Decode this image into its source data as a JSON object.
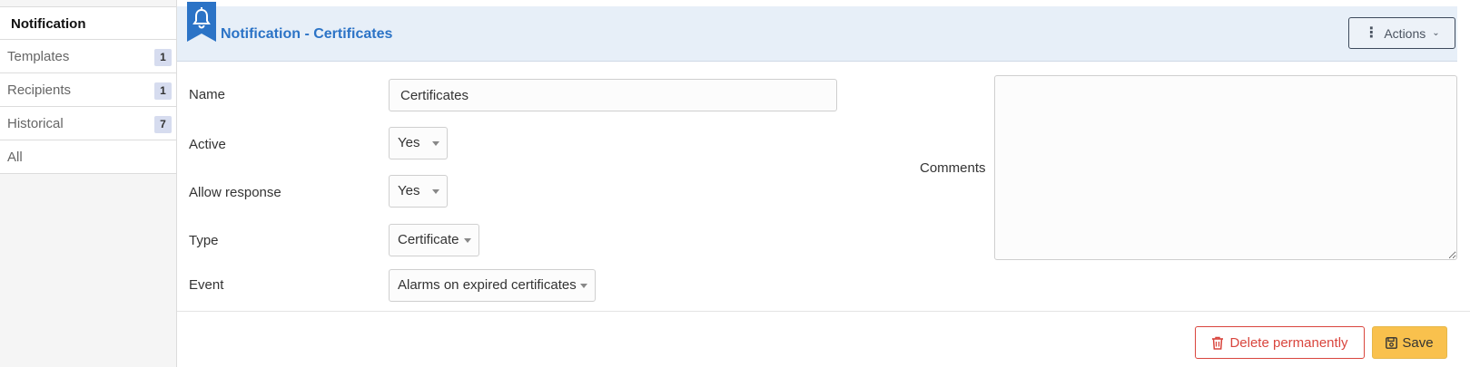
{
  "sidebar": {
    "heading": "Notification",
    "items": [
      {
        "label": "Templates",
        "badge": "1"
      },
      {
        "label": "Recipients",
        "badge": "1"
      },
      {
        "label": "Historical",
        "badge": "7"
      },
      {
        "label": "All",
        "badge": ""
      }
    ]
  },
  "header": {
    "title": "Notification - Certificates",
    "actions_label": "Actions",
    "icon": "bell-icon",
    "accent": "#2b73c6"
  },
  "form": {
    "name_label": "Name",
    "name_value": "Certificates",
    "active_label": "Active",
    "active_value": "Yes",
    "allow_response_label": "Allow response",
    "allow_response_value": "Yes",
    "type_label": "Type",
    "type_value": "Certificate",
    "event_label": "Event",
    "event_value": "Alarms on expired certificates",
    "comments_label": "Comments",
    "comments_value": ""
  },
  "footer": {
    "delete_label": "Delete permanently",
    "save_label": "Save",
    "delete_color": "#d9453d",
    "save_color": "#f9c14d"
  }
}
